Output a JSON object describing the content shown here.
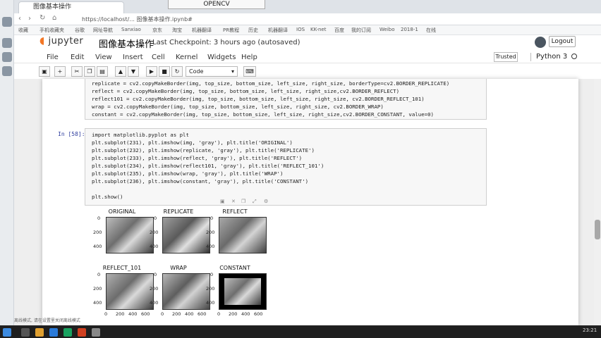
{
  "browser": {
    "tab_title": "图像基本操作",
    "overlay_title": "OPENCV",
    "url": "https://localhost/... 图像基本操作.ipynb#",
    "bookmarks": [
      "收藏",
      "手机收藏夹",
      "谷歌",
      "网址导航",
      "Sanxiao",
      "京东",
      "淘宝",
      "机器翻译",
      "PR教程",
      "历史",
      "机器翻译",
      "IOS",
      "KK-net",
      "百度",
      "我的订阅",
      "Weibo",
      "2018-1",
      "在线"
    ]
  },
  "jupyter": {
    "logo_text": "jupyter",
    "notebook_name": "图像基本操作",
    "checkpoint": "Last Checkpoint: 3 hours ago (autosaved)",
    "logout_label": "Logout",
    "menu": [
      "File",
      "Edit",
      "View",
      "Insert",
      "Cell",
      "Kernel",
      "Widgets",
      "Help"
    ],
    "trusted_label": "Trusted",
    "kernel_name": "Python 3",
    "cell_type": "Code"
  },
  "cells": {
    "cell1_lines": [
      "replicate = cv2.copyMakeBorder(img, top_size, bottom_size, left_size, right_size, borderType=cv2.BORDER_REPLICATE)",
      "reflect = cv2.copyMakeBorder(img, top_size, bottom_size, left_size, right_size,cv2.BORDER_REFLECT)",
      "reflect101 = cv2.copyMakeBorder(img, top_size, bottom_size, left_size, right_size, cv2.BORDER_REFLECT_101)",
      "wrap = cv2.copyMakeBorder(img, top_size, bottom_size, left_size, right_size, cv2.BORDER_WRAP)",
      "constant = cv2.copyMakeBorder(img, top_size, bottom_size, left_size, right_size,cv2.BORDER_CONSTANT, value=0)"
    ],
    "cell2_prompt": "In [58]:",
    "cell2_lines": [
      "import matplotlib.pyplot as plt",
      "plt.subplot(231), plt.imshow(img, 'gray'), plt.title('ORIGINAL')",
      "plt.subplot(232), plt.imshow(replicate, 'gray'), plt.title('REPLICATE')",
      "plt.subplot(233), plt.imshow(reflect, 'gray'), plt.title('REFLECT')",
      "plt.subplot(234), plt.imshow(reflect101, 'gray'), plt.title('REFLECT_101')",
      "plt.subplot(235), plt.imshow(wrap, 'gray'), plt.title('WRAP')",
      "plt.subplot(236), plt.imshow(constant, 'gray'), plt.title('CONSTANT')",
      "",
      "plt.show()"
    ]
  },
  "figure": {
    "titles": [
      "ORIGINAL",
      "REPLICATE",
      "REFLECT",
      "REFLECT_101",
      "WRAP",
      "CONSTANT"
    ],
    "yticks": [
      "0",
      "200",
      "400"
    ],
    "xticks": [
      "0",
      "200",
      "400",
      "600"
    ]
  },
  "status": {
    "left_text": "离线模式, 请在设置里关闭离线模式",
    "clock": "23:21"
  }
}
